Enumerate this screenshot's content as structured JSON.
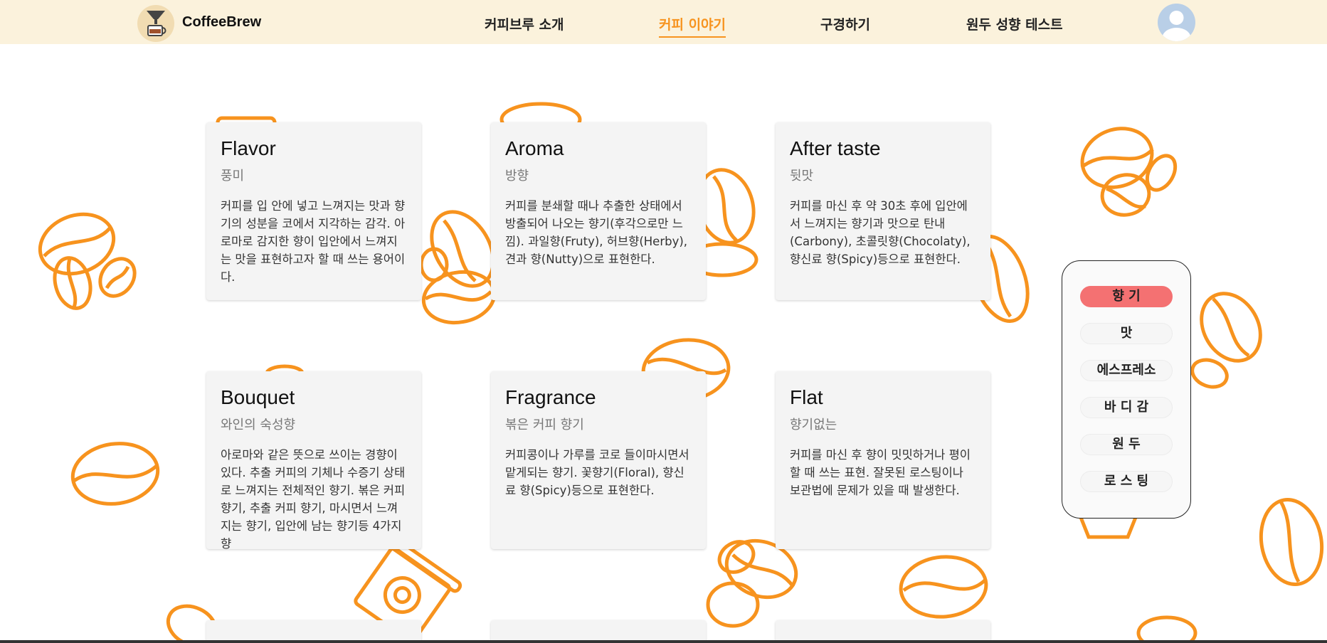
{
  "header": {
    "brand": "CoffeeBrew",
    "nav": [
      {
        "label": "커피브루 소개"
      },
      {
        "label": "커피 이야기"
      },
      {
        "label": "구경하기"
      },
      {
        "label": "원두 성향 테스트"
      }
    ],
    "active_nav": "커피 이야기"
  },
  "cards": [
    {
      "title": "Flavor",
      "subtitle": "풍미",
      "desc": "커피를 입 안에 넣고 느껴지는 맛과 향기의 성분을 코에서 지각하는 감각. 아로마로 감지한 향이 입안에서 느껴지는 맛을 표현하고자 할 때 쓰는 용어이다."
    },
    {
      "title": "Aroma",
      "subtitle": "방향",
      "desc": "커피를 분쇄할 때나 추출한 상태에서 방출되어 나오는 향기(후각으로만 느낌). 과일향(Fruty), 허브향(Herby), 견과 향(Nutty)으로 표현한다."
    },
    {
      "title": "After taste",
      "subtitle": "뒷맛",
      "desc": "커피를 마신 후 약 30초 후에 입안에서 느껴지는 향기과 맛으로 탄내(Carbony), 초콜릿향(Chocolaty), 향신료 향(Spicy)등으로 표현한다."
    },
    {
      "title": "Bouquet",
      "subtitle": "와인의 숙성향",
      "desc": "아로마와 같은 뜻으로 쓰이는 경향이 있다. 추출 커피의 기체나 수증기 상태로 느껴지는 전체적인 향기. 볶은 커피 향기, 추출 커피 향기, 마시면서 느껴지는 향기, 입안에 남는 향기등 4가지 향"
    },
    {
      "title": "Fragrance",
      "subtitle": "볶은 커피 향기",
      "desc": "커피콩이나 가루를 코로 들이마시면서 맡게되는 향기. 꽃향기(Floral), 향신료 향(Spicy)등으로 표현한다."
    },
    {
      "title": "Flat",
      "subtitle": "향기없는",
      "desc": "커피를 마신 후 향이 밋밋하거나 평이할 때 쓰는 표현. 잘못된 로스팅이나 보관법에 문제가 있을 때 발생한다."
    }
  ],
  "side_menu": {
    "items": [
      {
        "label": "향 기"
      },
      {
        "label": "맛"
      },
      {
        "label": "에스프레소"
      },
      {
        "label": "바 디 감"
      },
      {
        "label": "원 두"
      },
      {
        "label": "로 스 팅"
      }
    ],
    "active": "향 기"
  },
  "colors": {
    "accent": "#f7931e",
    "header_bg": "#fbf2dc",
    "menu_active": "#f47172",
    "bean_outline": "#f7931e"
  }
}
